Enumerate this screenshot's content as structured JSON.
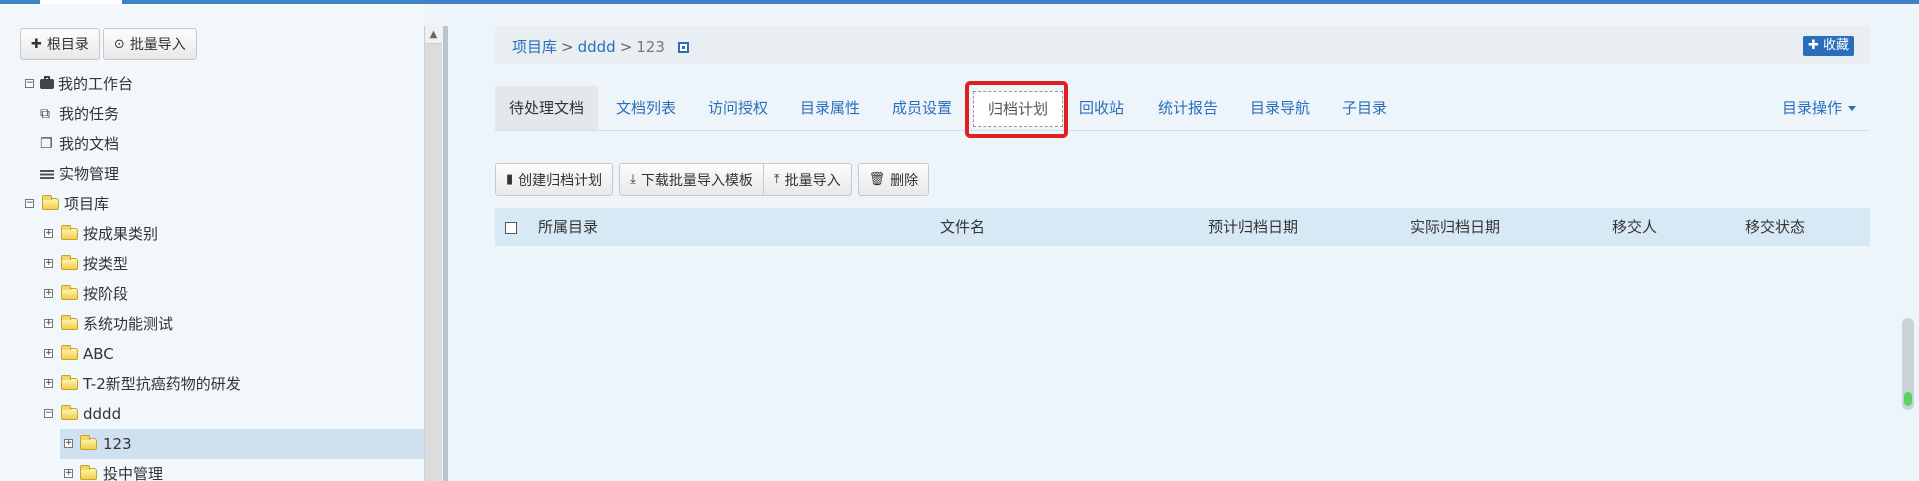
{
  "sidebar": {
    "root_button": "根目录",
    "import_button": "批量导入",
    "tree": [
      {
        "label": "我的工作台"
      },
      {
        "label": "我的任务"
      },
      {
        "label": "我的文档"
      },
      {
        "label": "实物管理"
      },
      {
        "label": "项目库"
      },
      {
        "label": "按成果类别"
      },
      {
        "label": "按类型"
      },
      {
        "label": "按阶段"
      },
      {
        "label": "系统功能测试"
      },
      {
        "label": "ABC"
      },
      {
        "label": "T-2新型抗癌药物的研发"
      },
      {
        "label": "dddd"
      },
      {
        "label": "123"
      },
      {
        "label": "投中管理"
      }
    ]
  },
  "breadcrumb": {
    "items": [
      "项目库",
      "dddd"
    ],
    "current": "123",
    "separator": ">",
    "favorite_button": "收藏"
  },
  "tabs": {
    "items": [
      {
        "label": "待处理文档"
      },
      {
        "label": "文档列表"
      },
      {
        "label": "访问授权"
      },
      {
        "label": "目录属性"
      },
      {
        "label": "成员设置"
      },
      {
        "label": "归档计划"
      },
      {
        "label": "回收站"
      },
      {
        "label": "统计报告"
      },
      {
        "label": "目录导航"
      },
      {
        "label": "子目录"
      }
    ],
    "menu_label": "目录操作"
  },
  "actions": {
    "create_plan": "创建归档计划",
    "download_template": "下载批量导入模板",
    "batch_import": "批量导入",
    "delete": "删除"
  },
  "table": {
    "columns": [
      "所属目录",
      "文件名",
      "预计归档日期",
      "实际归档日期",
      "移交人",
      "移交状态"
    ]
  },
  "colors": {
    "link": "#2a6ebb",
    "highlight": "#e02020",
    "selected_row": "#cfe1f0",
    "table_header": "#d6e9f4"
  }
}
